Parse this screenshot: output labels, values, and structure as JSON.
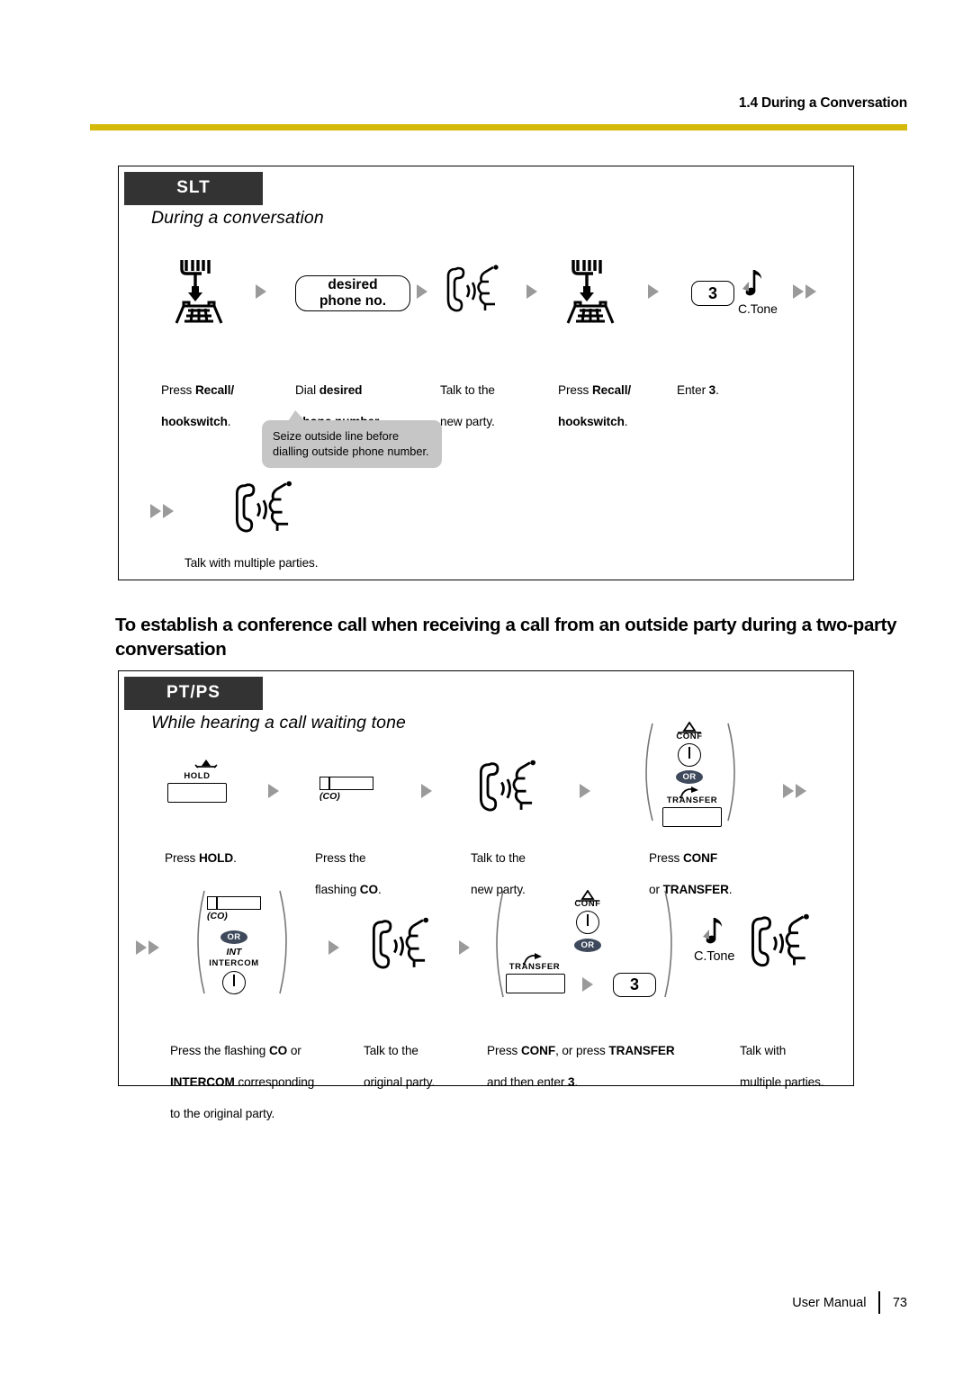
{
  "header": {
    "section_title": "1.4 During a Conversation",
    "rule_color": "#d4b908"
  },
  "slt_box": {
    "tag": "SLT",
    "subtitle": "During a conversation",
    "steps_row1": [
      {
        "icon": "hookswitch-icon",
        "caption_plain1": "Press ",
        "caption_bold1": "Recall/",
        "caption_bold2": "hookswitch",
        "caption_plain2": "."
      },
      {
        "icon": "pill",
        "pill_line1": "desired",
        "pill_line2": "phone no.",
        "caption_plain1": "Dial ",
        "caption_bold1": "desired",
        "caption_bold2": "phone number",
        "caption_plain2": "."
      },
      {
        "icon": "talk-icon",
        "caption_plain1": "Talk to the",
        "caption_plain2": "new party."
      },
      {
        "icon": "hookswitch-icon",
        "caption_plain1": "Press ",
        "caption_bold1": "Recall/",
        "caption_bold2": "hookswitch",
        "caption_plain2": "."
      },
      {
        "icon": "keycap",
        "keycap": "3",
        "tone_label": "C.Tone",
        "caption_plain1": "Enter ",
        "caption_bold1": "3",
        "caption_plain2": "."
      }
    ],
    "bubble": {
      "line1": "Seize outside line before",
      "line2": "dialling outside phone number."
    },
    "final_row": {
      "icon": "talk-icon",
      "caption": "Talk with multiple parties."
    }
  },
  "section_heading": "To establish a conference call when receiving a call from an outside party during a two-party conversation",
  "ptps_box": {
    "tag": "PT/PS",
    "subtitle": "While hearing a call waiting tone",
    "row1": {
      "hold_key_label": "HOLD",
      "co_key_label": "(CO)",
      "conf_label": "CONF",
      "or_label": "OR",
      "transfer_label": "TRANSFER",
      "captions": [
        {
          "plain1": "Press ",
          "bold1": "HOLD",
          "plain2": "."
        },
        {
          "plain1": "Press the",
          "plain2": "flashing ",
          "bold2": "CO",
          "plain3": "."
        },
        {
          "plain1": "Talk to the",
          "plain2": "new party."
        },
        {
          "plain1": "Press ",
          "bold1": "CONF",
          "plain2": "or ",
          "bold2": "TRANSFER",
          "plain3": "."
        }
      ]
    },
    "row2": {
      "co_key_label": "(CO)",
      "or_label": "OR",
      "int_label": "INT",
      "intercom_label": "INTERCOM",
      "conf_label": "CONF",
      "transfer_label": "TRANSFER",
      "keycap": "3",
      "tone_label": "C.Tone",
      "captions": [
        {
          "line1_plain": "Press the flashing ",
          "line1_bold": "CO",
          "line1_tail": " or",
          "line2_bold": "INTERCOM",
          "line2_plain": " corresponding",
          "line3_plain": "to the original party."
        },
        {
          "line1_plain": "Talk to the",
          "line2_plain": "original party."
        },
        {
          "line1_plain": "Press ",
          "line1_bold": "CONF",
          "line1_mid": ", or press ",
          "line1_bold2": "TRANSFER",
          "line2_plain": "and then enter ",
          "line2_bold": "3",
          "line2_tail": "."
        },
        {
          "line1_plain": "Talk with",
          "line2_plain": "multiple parties."
        }
      ]
    }
  },
  "footer": {
    "manual_label": "User Manual",
    "page_number": "73"
  }
}
